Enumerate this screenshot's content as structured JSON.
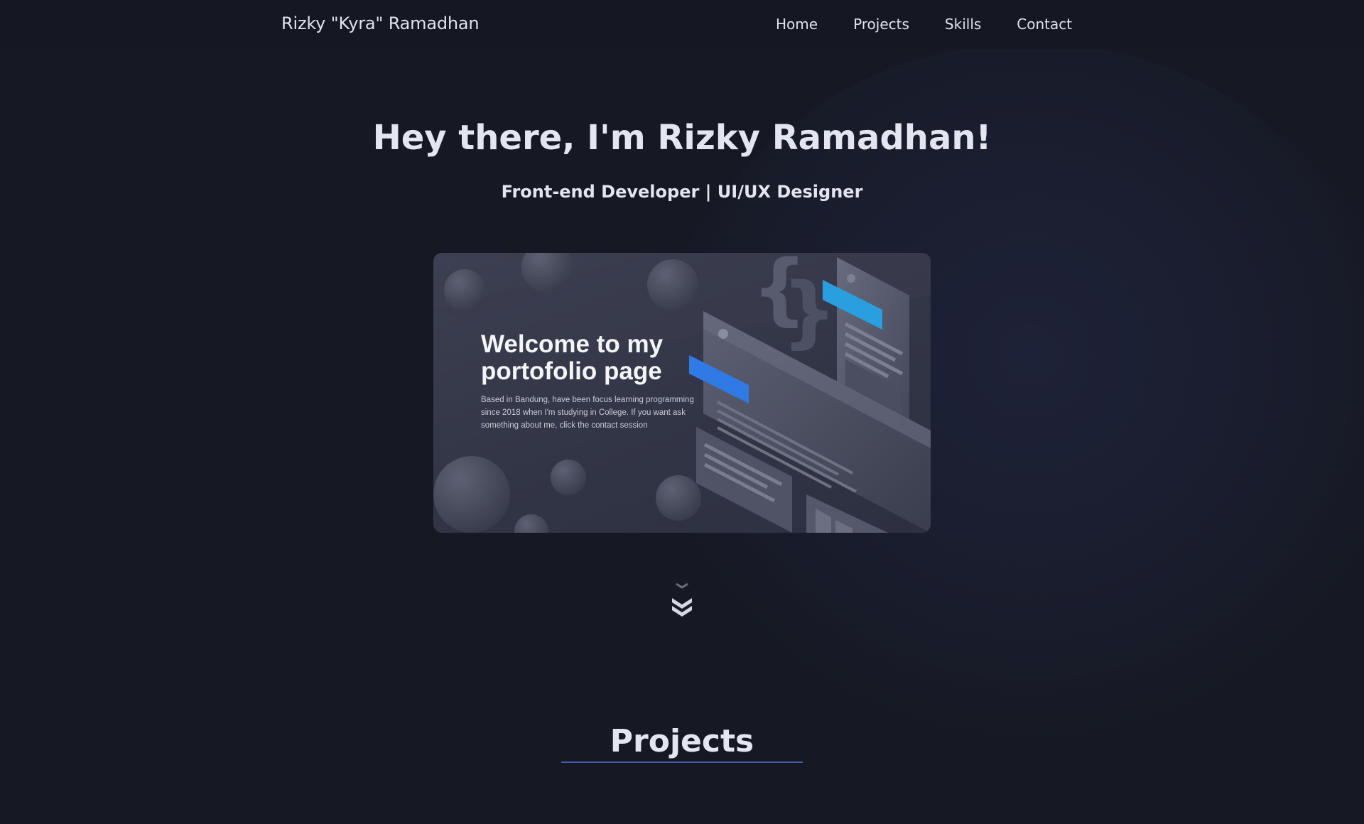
{
  "nav": {
    "brand": "Rizky \"Kyra\" Ramadhan",
    "links": [
      "Home",
      "Projects",
      "Skills",
      "Contact"
    ]
  },
  "hero": {
    "title": "Hey there, I'm Rizky Ramadhan!",
    "subtitle": "Front-end Developer | UI/UX Designer"
  },
  "banner": {
    "title": "Welcome to my portofolio page",
    "description": "Based in Bandung, have been focus learning programming since 2018 when I'm studying in College. If you want ask something about me, click the contact session"
  },
  "projects": {
    "title": "Projects"
  },
  "colors": {
    "background": "#161923",
    "accent_blue": "#2f7ae5",
    "accent_cyan": "#2a9fe0",
    "underline": "#4b59b0"
  },
  "icons": {
    "scroll": "chevron-double-down-icon"
  }
}
